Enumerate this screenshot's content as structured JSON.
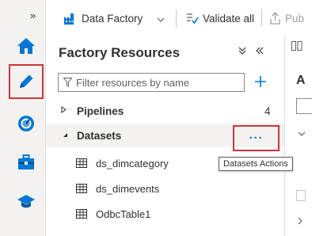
{
  "rail": {
    "collapse_glyph": "»",
    "items": [
      {
        "icon": "home-icon",
        "color": "#0078d4"
      },
      {
        "icon": "pencil-icon",
        "color": "#0078d4",
        "selected": true
      },
      {
        "icon": "monitor-gauge-icon",
        "color": "#0078d4"
      },
      {
        "icon": "toolbox-icon",
        "color": "#0078d4"
      },
      {
        "icon": "graduation-cap-icon",
        "color": "#0078d4"
      }
    ]
  },
  "toolbar": {
    "factory_label": "Data Factory",
    "validate_label": "Validate all",
    "publish_label": "Pub"
  },
  "panel": {
    "title": "Factory Resources",
    "search_placeholder": "Filter resources by name",
    "tree": {
      "pipelines": {
        "label": "Pipelines",
        "count": "4",
        "expanded": false
      },
      "datasets": {
        "label": "Datasets",
        "expanded": true,
        "actions_glyph": "···",
        "actions_tooltip": "Datasets Actions",
        "items": [
          "ds_dimcategory",
          "ds_dimevents",
          "OdbcTable1"
        ]
      }
    }
  },
  "canvas": {
    "partial_heading": "A"
  },
  "colors": {
    "accent": "#0078d4",
    "highlight_border": "#d13438",
    "rail_bg": "#f3f2f1",
    "selected_row_bg": "#f3f2f1"
  }
}
